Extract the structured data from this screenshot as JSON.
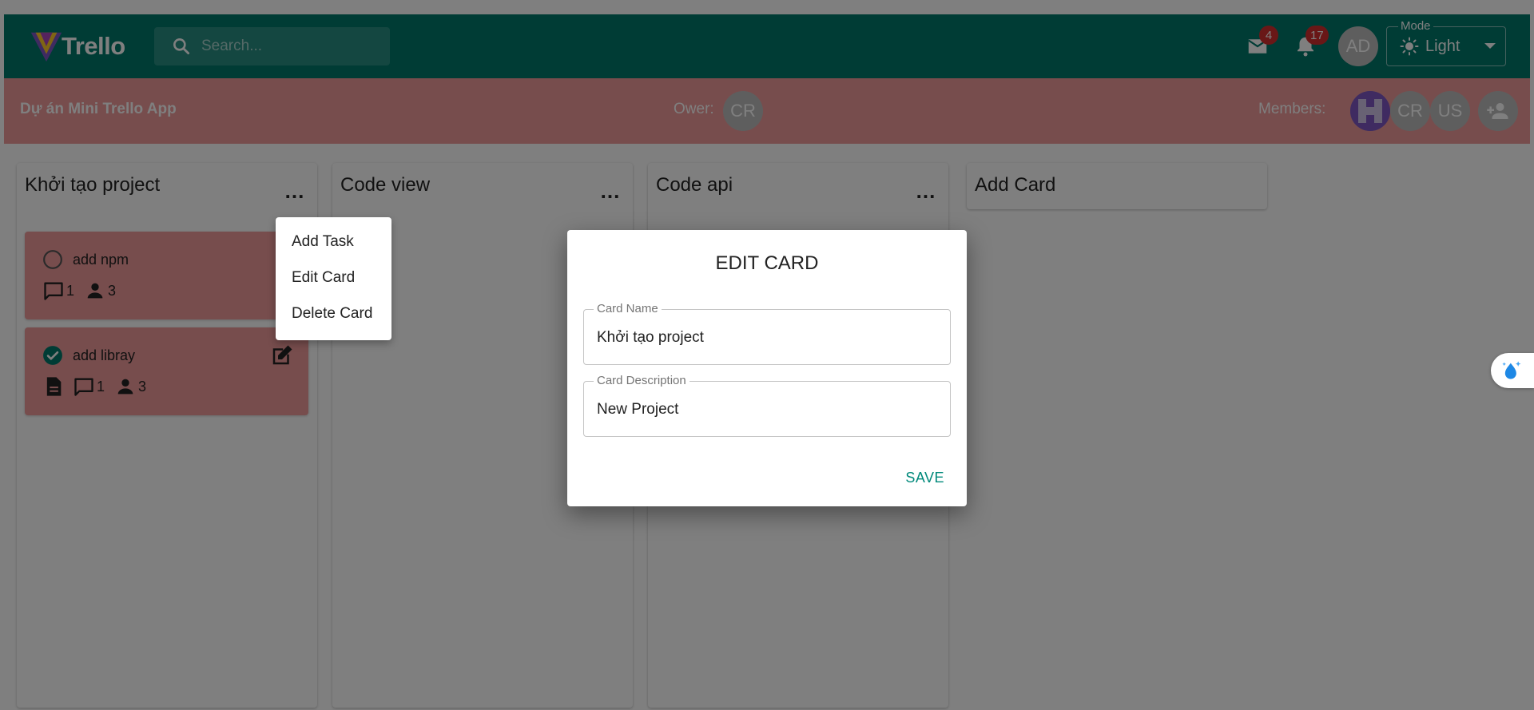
{
  "app": {
    "logo_text": "Trello",
    "search_placeholder": "Search...",
    "mail_count": "4",
    "notification_count": "17",
    "user_initials": "AD",
    "mode_label": "Mode",
    "mode_value": "Light"
  },
  "board": {
    "title": "Dự án Mini Trello App",
    "owner_label": "Ower:",
    "owner_initials": "CR",
    "members_label": "Members:",
    "members": [
      "CR",
      "US"
    ]
  },
  "columns": [
    {
      "title": "Khởi tạo project",
      "more": "...",
      "tasks": [
        {
          "name": "add npm",
          "comments": "1",
          "members": "3",
          "done": false
        },
        {
          "name": "add libray",
          "comments": "1",
          "members": "3",
          "done": true
        }
      ]
    },
    {
      "title": "Code view",
      "more": "..."
    },
    {
      "title": "Code api",
      "more": "..."
    }
  ],
  "add_card_label": "Add Card",
  "menu": {
    "items": [
      "Add Task",
      "Edit Card",
      "Delete Card"
    ]
  },
  "dialog": {
    "title": "EDIT CARD",
    "name_label": "Card Name",
    "name_value": "Khởi tạo project",
    "desc_label": "Card Description",
    "desc_value": "New Project",
    "save_label": "SAVE"
  },
  "colors": {
    "appbar": "#00796b",
    "board_header": "#ef9a9a",
    "task_card": "#ef9a9a",
    "badge": "#d32f2f",
    "accent": "#00897b"
  }
}
